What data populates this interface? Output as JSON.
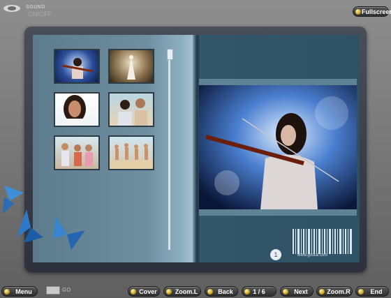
{
  "sound": {
    "label": "SOUND",
    "toggle": "ON/OFF"
  },
  "top": {
    "fullscreen": "Fullscreen"
  },
  "book": {
    "barcode_url": "www.gostal.com",
    "page_badge": "1"
  },
  "toolbar": {
    "menu": "Menu",
    "go": "GO",
    "cover": "Cover",
    "zoom_l": "Zoom.L",
    "back": "Back",
    "page_indicator": "1 / 6",
    "next": "Next",
    "zoom_r": "Zoom.R",
    "end": "End"
  },
  "colors": {
    "accent_dot": "#c9a020",
    "page_dark": "#2f5164",
    "page_light": "#6f8fa1"
  },
  "icons": [
    "speaker-icon",
    "butterfly-icon",
    "scroll-thumb"
  ]
}
